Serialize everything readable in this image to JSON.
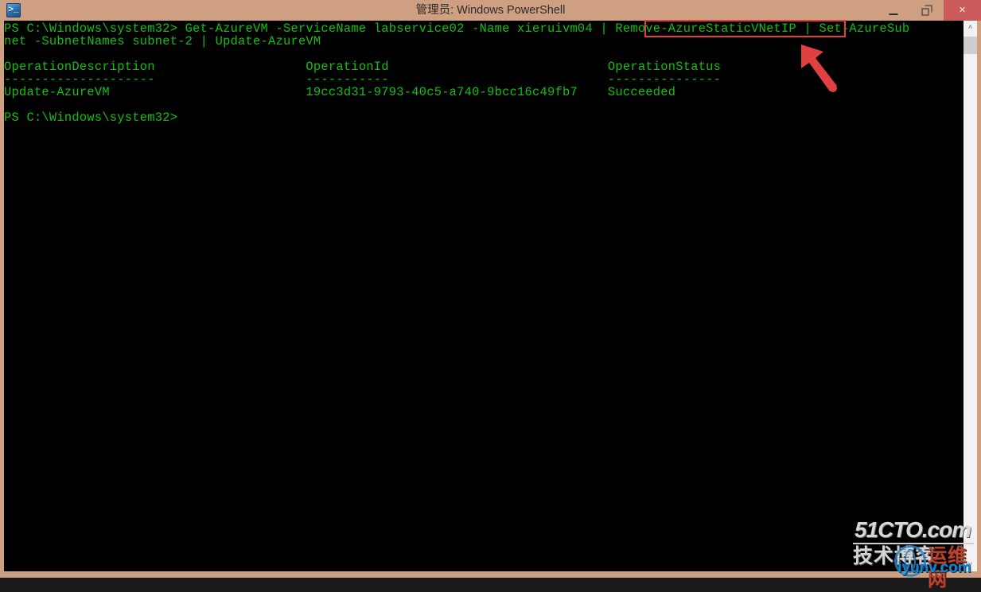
{
  "window": {
    "title": "管理员: Windows PowerShell",
    "app_icon": "powershell-icon",
    "frame_color": "#ce9f80",
    "console_bg": "#000000",
    "console_fg": "#12c00e",
    "controls": {
      "minimize": "minimize",
      "restore": "restore",
      "close": "×",
      "close_color": "#cb5a5a"
    }
  },
  "console": {
    "lines": [
      "PS C:\\Windows\\system32> Get-AzureVM -ServiceName labservice02 -Name xieruivm04 | Remove-AzureStaticVNetIP | Set-AzureSub",
      "net -SubnetNames subnet-2 | Update-AzureVM",
      "",
      "OperationDescription                    OperationId                             OperationStatus",
      "--------------------                    -----------                             ---------------",
      "Update-AzureVM                          19cc3d31-9793-40c5-a740-9bcc16c49fb7    Succeeded",
      "",
      "PS C:\\Windows\\system32>"
    ],
    "prompt": "PS C:\\Windows\\system32>",
    "command": "Get-AzureVM -ServiceName labservice02 -Name xieruivm04 | Remove-AzureStaticVNetIP | Set-AzureSubnet -SubnetNames subnet-2 | Update-AzureVM",
    "table": {
      "headers": [
        "OperationDescription",
        "OperationId",
        "OperationStatus"
      ],
      "rows": [
        [
          "Update-AzureVM",
          "19cc3d31-9793-40c5-a740-9bcc16c49fb7",
          "Succeeded"
        ]
      ]
    }
  },
  "annotations": {
    "highlight_text": "Remove-AzureStaticVNetIP",
    "highlight_color": "#e04040",
    "arrow_color": "#e04040",
    "arrow_name": "red-pointer-arrow"
  },
  "scrollbar": {
    "up_arrow": "˄",
    "down_arrow": "˅"
  },
  "watermark": {
    "top": "51CTO.com",
    "mid": "技术博客",
    "red": "运维网",
    "bottom": "iyunv.com"
  }
}
